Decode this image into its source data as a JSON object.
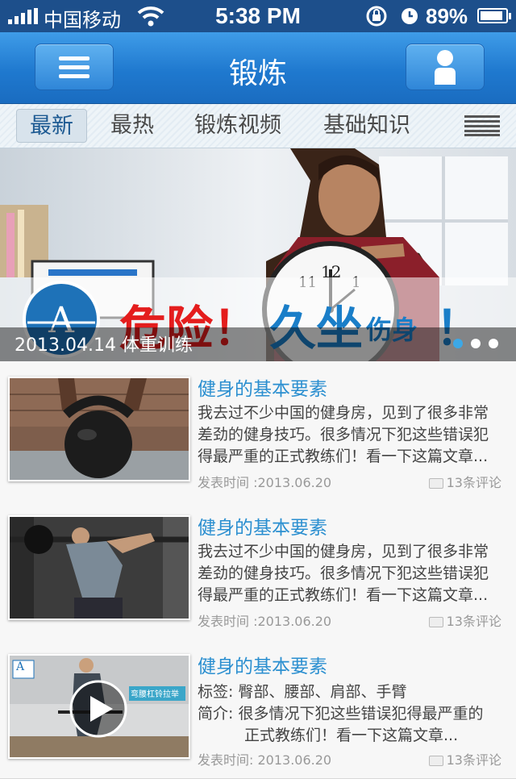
{
  "status_bar": {
    "carrier": "中国移动",
    "time": "5:38 PM",
    "battery_pct": "89%",
    "battery_level": 0.89,
    "icons": [
      "signal-icon",
      "wifi-icon",
      "rotation-lock-icon",
      "alarm-icon",
      "battery-icon"
    ]
  },
  "navbar": {
    "title": "锻炼",
    "left_icon": "menu-icon",
    "right_icon": "user-icon",
    "color": "#2b86d6"
  },
  "tabs": {
    "items": [
      {
        "label": "最新",
        "active": true
      },
      {
        "label": "最热",
        "active": false
      },
      {
        "label": "锻炼视频",
        "active": false
      },
      {
        "label": "基础知识",
        "active": false
      }
    ],
    "more_icon": "list-icon"
  },
  "banner": {
    "caption": "2013.04.14 体重训练",
    "headline_part1": "危险！",
    "headline_part2": "久坐",
    "headline_part3": "伤身",
    "headline_part4": "！",
    "page_count": 3,
    "active_page": 1,
    "accent": "#3da8e6"
  },
  "articles": [
    {
      "title": "健身的基本要素",
      "body_lines": [
        "我去过不少中国的健身房，见到了很多非常",
        "差劲的健身技巧。很多情况下犯这些错误犯",
        "得最严重的正式教练们！看一下这篇文章..."
      ],
      "date": "发表时间 :2013.06.20",
      "comments": "13条评论",
      "thumb": "kettlebell"
    },
    {
      "title": "健身的基本要素",
      "body_lines": [
        "我去过不少中国的健身房，见到了很多非常",
        "差劲的健身技巧。很多情况下犯这些错误犯",
        "得最严重的正式教练们！看一下这篇文章..."
      ],
      "date": "发表时间 :2013.06.20",
      "comments": "13条评论",
      "thumb": "squat"
    },
    {
      "title": "健身的基本要素",
      "tags_label": "标签:",
      "tags": "臀部、腰部、肩部、手臂",
      "intro_label": "简介:",
      "intro_lines": [
        "很多情况下犯这些错误犯得最严重的",
        "正式教练们！看一下这篇文章..."
      ],
      "date": "发表时间: 2013.06.20",
      "comments": "13条评论",
      "thumb": "video",
      "thumb_text": "弯腰杠铃拉举",
      "thumb_logo": "A"
    }
  ]
}
